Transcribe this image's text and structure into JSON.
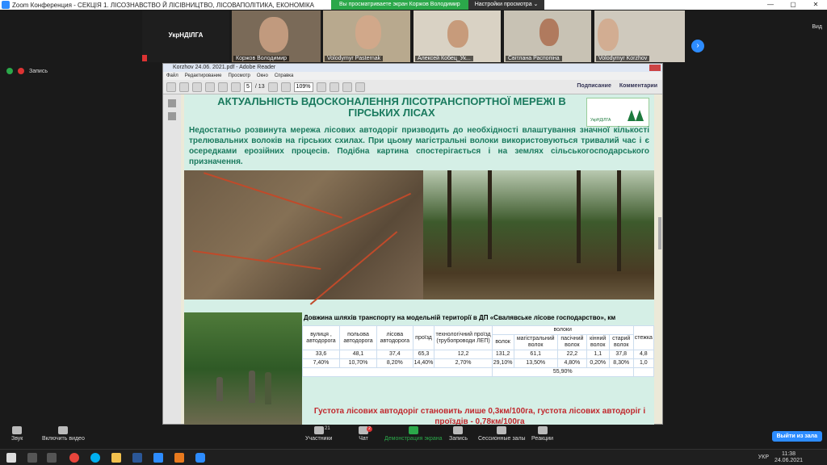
{
  "window": {
    "title": "Zoom Конференция - СЕКЦІЯ 1. ЛІСОЗНАВСТВО Й ЛІСІВНИЦТВО, ЛІСОВАПОЛІТИКА, ЕКОНОМІКА"
  },
  "share_banner": {
    "viewing": "Вы просматриваете экран Коржов Володимир",
    "settings": "Настройки просмотра ⌄"
  },
  "gallery": {
    "view_label": "Вид",
    "participants": [
      {
        "name": "УкрНДІЛГА",
        "video": false
      },
      {
        "name": "Коржов Володимир",
        "video": true
      },
      {
        "name": "Volodymyr Pasternak",
        "video": true
      },
      {
        "name": "Алексей Кобец_Ук...",
        "video": true
      },
      {
        "name": "Світлана Распопіна",
        "video": true
      },
      {
        "name": "Volodymyr Korzhov",
        "video": true
      }
    ]
  },
  "recording": {
    "label": "Запись"
  },
  "reader": {
    "title": "Korzhov 24.06. 2021.pdf - Adobe Reader",
    "menu": [
      "Файл",
      "Редактирование",
      "Просмотр",
      "Окно",
      "Справка"
    ],
    "page_current": "5",
    "page_total": "/ 13",
    "zoom": "109%",
    "links": [
      "Подписание",
      "Комментарии"
    ]
  },
  "slide": {
    "title": "АКТУАЛЬНІСТЬ ВДОСКОНАЛЕННЯ ЛІСОТРАНСПОРТНОЇ МЕРЕЖІ В ГІРСЬКИХ ЛІСАХ",
    "logo_text": "УкрНДІЛГА",
    "text": "Недостатньо розвинута мережа лісових автодоріг призводить до необхідності влаштування значної кількості трелювальних волоків на гірських схилах. При цьому магістральні волоки використовуються тривалий час і є осередками ерозійних процесів. Подібна картина спостерігається і на землях сільськогосподарського призначення.",
    "table_title": "Довжина шляхів транспорту на модельній території в ДП «Свалявське лісове господарство», км",
    "headers": {
      "street": "вулиця , автодорога",
      "field": "польова автодорога",
      "forest": "лісова автодорога",
      "drive": "проїзд",
      "tech": "технологічний проїзд (трубопроводи ЛЕП)",
      "voloky": "волоки",
      "volok": "волок",
      "main": "магістральний волок",
      "pasichnyi": "пасічний волок",
      "kinnyi": "кінний волок",
      "staryi": "старий волок",
      "path": "стежка"
    },
    "rows": [
      [
        "33,6",
        "48,1",
        "37,4",
        "65,3",
        "12,2",
        "131,2",
        "61,1",
        "22,2",
        "1,1",
        "37,8",
        "4,8"
      ],
      [
        "7,40%",
        "10,70%",
        "8,20%",
        "14,40%",
        "2,70%",
        "29,10%",
        "13,50%",
        "4,80%",
        "0,20%",
        "8,30%",
        "1,0"
      ]
    ],
    "total_voloky": "55,90%",
    "density_text": "Густота лісових автодоріг становить лише 0,3км/100га, густота лісових автодоріг і проїздів - 0,78км/100га"
  },
  "controls": {
    "audio": "Звук",
    "video": "Включить видео",
    "participants": "Участники",
    "participants_count": "21",
    "chat": "Чат",
    "chat_badge": "2",
    "share": "Демонстрация экрана",
    "record": "Запись",
    "rooms": "Сессионные залы",
    "reactions": "Реакции",
    "leave": "Выйти из зала"
  },
  "taskbar": {
    "lang": "УКР",
    "time": "11:38",
    "date": "24.06.2021"
  }
}
